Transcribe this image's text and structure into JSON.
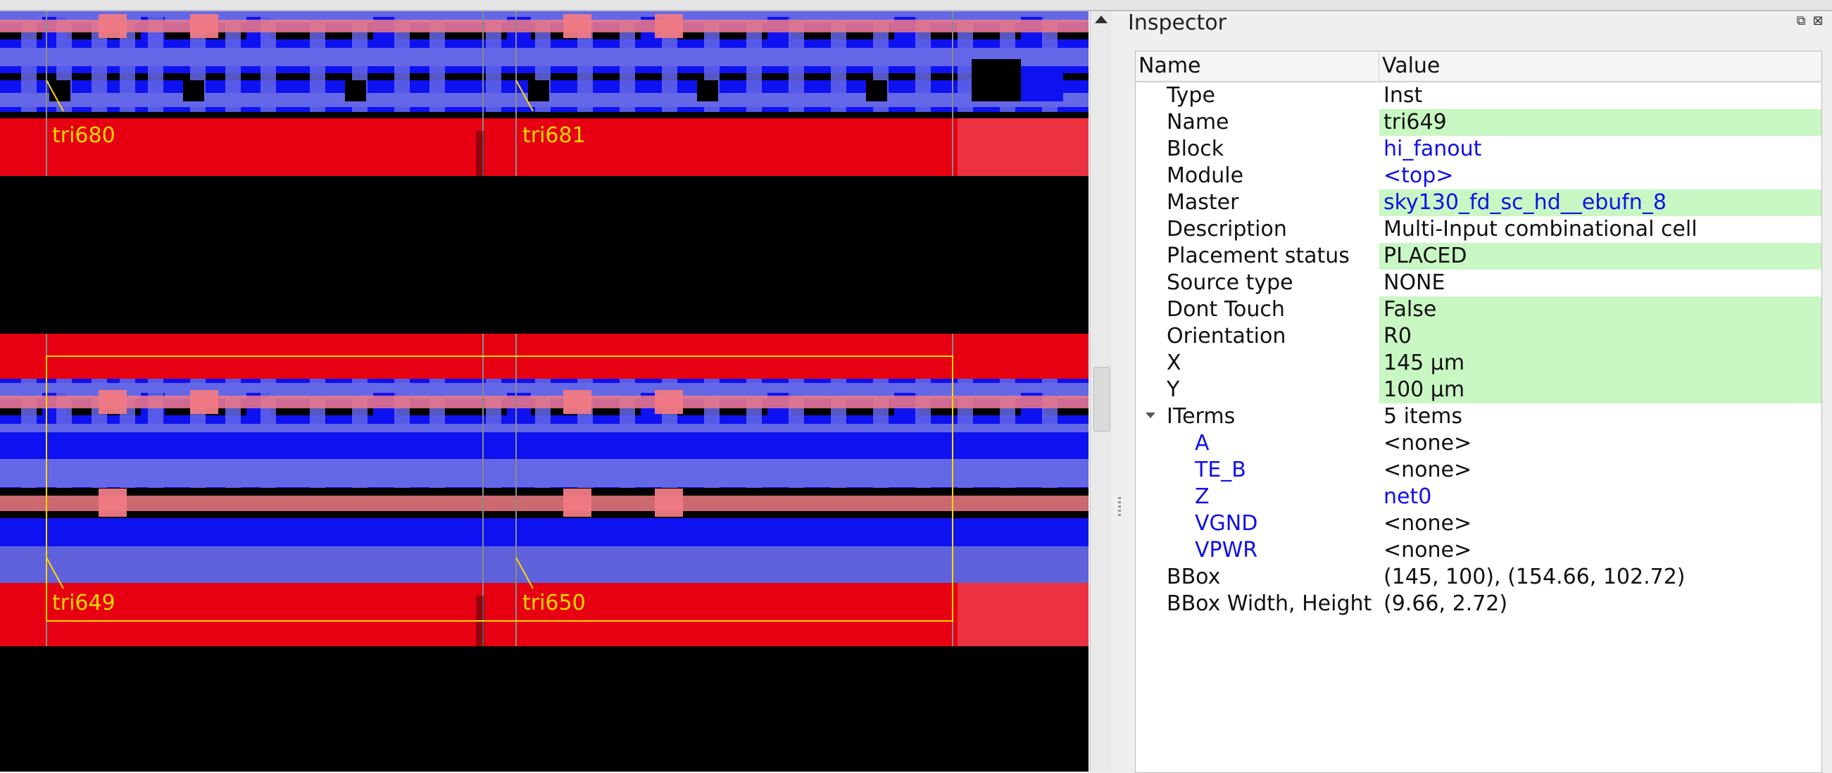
{
  "layout_view": {
    "cell_labels": [
      "tri680",
      "tri681",
      "tri649",
      "tri650"
    ],
    "colors": {
      "background": "#000000",
      "rail": "#e60012",
      "metal_dark": "#0e12f0",
      "metal_light": "#6467e6",
      "poly": "#f07a84",
      "selection": "#ffd800"
    }
  },
  "inspector": {
    "title": "Inspector",
    "float_icon": "float-icon",
    "close_icon": "close-icon",
    "columns": {
      "name": "Name",
      "value": "Value"
    },
    "rows": [
      {
        "name": "Type",
        "value": "Inst",
        "highlight": false,
        "link": false
      },
      {
        "name": "Name",
        "value": "tri649",
        "highlight": true,
        "link": false
      },
      {
        "name": "Block",
        "value": "hi_fanout",
        "highlight": false,
        "link": true
      },
      {
        "name": "Module",
        "value": "<top>",
        "highlight": false,
        "link": true
      },
      {
        "name": "Master",
        "value": "sky130_fd_sc_hd__ebufn_8",
        "highlight": true,
        "link": true
      },
      {
        "name": "Description",
        "value": "Multi-Input combinational cell",
        "highlight": false,
        "link": false
      },
      {
        "name": "Placement status",
        "value": "PLACED",
        "highlight": true,
        "link": false
      },
      {
        "name": "Source type",
        "value": "NONE",
        "highlight": false,
        "link": false
      },
      {
        "name": "Dont Touch",
        "value": "False",
        "highlight": true,
        "link": false
      },
      {
        "name": "Orientation",
        "value": "R0",
        "highlight": true,
        "link": false
      },
      {
        "name": "X",
        "value": "145 μm",
        "highlight": true,
        "link": false
      },
      {
        "name": "Y",
        "value": "100 μm",
        "highlight": true,
        "link": false
      },
      {
        "name": "ITerms",
        "value": "5 items",
        "highlight": false,
        "link": false,
        "expanded": true
      },
      {
        "name": "A",
        "value": "<none>",
        "highlight": false,
        "link": false,
        "child": true
      },
      {
        "name": "TE_B",
        "value": "<none>",
        "highlight": false,
        "link": false,
        "child": true
      },
      {
        "name": "Z",
        "value": "net0",
        "highlight": false,
        "link": true,
        "child": true
      },
      {
        "name": "VGND",
        "value": "<none>",
        "highlight": false,
        "link": false,
        "child": true
      },
      {
        "name": "VPWR",
        "value": "<none>",
        "highlight": false,
        "link": false,
        "child": true
      },
      {
        "name": "BBox",
        "value": "(145, 100), (154.66, 102.72)",
        "highlight": false,
        "link": false
      },
      {
        "name": "BBox Width, Height",
        "value": "(9.66, 2.72)",
        "highlight": false,
        "link": false
      }
    ]
  }
}
